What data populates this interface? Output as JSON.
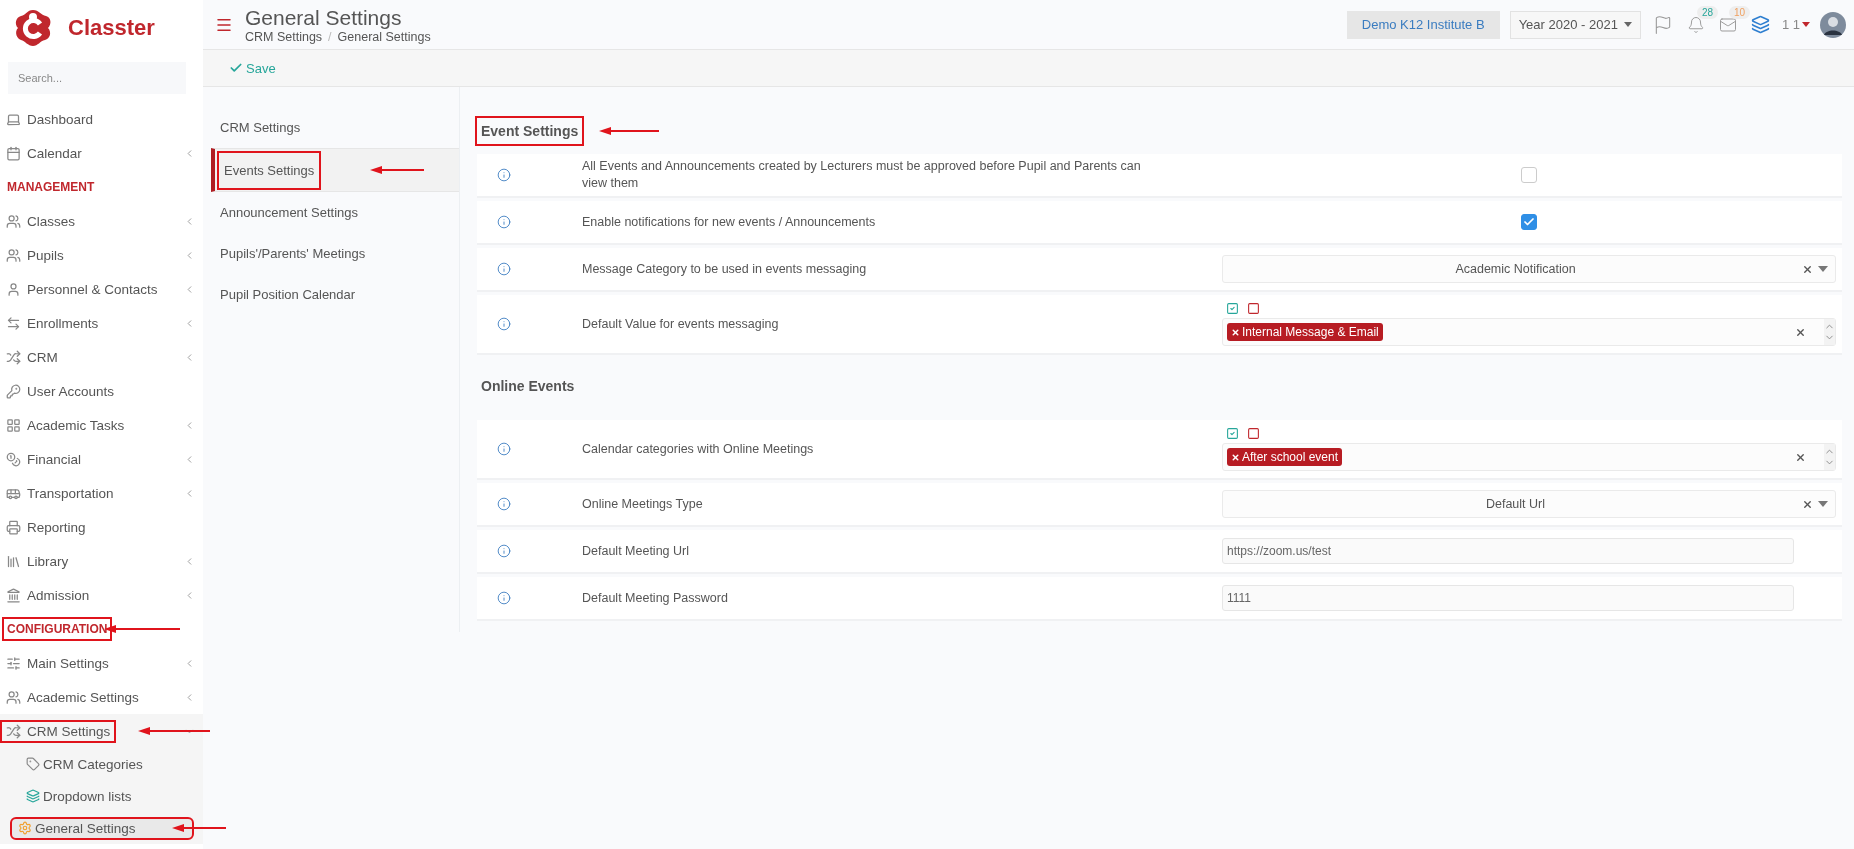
{
  "brand": {
    "name": "Classter"
  },
  "sidebar": {
    "search": {
      "placeholder": "Search..."
    },
    "items": [
      {
        "kind": "item",
        "label": "Dashboard",
        "submenu": false,
        "annotated": false
      },
      {
        "kind": "item",
        "label": "Calendar",
        "submenu": true,
        "expanded": false,
        "annotated": false
      },
      {
        "kind": "section",
        "label": "MANAGEMENT",
        "annotated": false
      },
      {
        "kind": "item",
        "label": "Classes",
        "submenu": true,
        "expanded": false,
        "annotated": false
      },
      {
        "kind": "item",
        "label": "Pupils",
        "submenu": true,
        "expanded": false,
        "annotated": false
      },
      {
        "kind": "item",
        "label": "Personnel & Contacts",
        "submenu": true,
        "expanded": false,
        "annotated": false
      },
      {
        "kind": "item",
        "label": "Enrollments",
        "submenu": true,
        "expanded": false,
        "annotated": false
      },
      {
        "kind": "item",
        "label": "CRM",
        "submenu": true,
        "expanded": false,
        "annotated": false
      },
      {
        "kind": "item",
        "label": "User Accounts",
        "submenu": false,
        "annotated": false
      },
      {
        "kind": "item",
        "label": "Academic Tasks",
        "submenu": true,
        "expanded": false,
        "annotated": false
      },
      {
        "kind": "item",
        "label": "Financial",
        "submenu": true,
        "expanded": false,
        "annotated": false
      },
      {
        "kind": "item",
        "label": "Transportation",
        "submenu": true,
        "expanded": false,
        "annotated": false
      },
      {
        "kind": "item",
        "label": "Reporting",
        "submenu": false,
        "annotated": false
      },
      {
        "kind": "item",
        "label": "Library",
        "submenu": true,
        "expanded": false,
        "annotated": false
      },
      {
        "kind": "item",
        "label": "Admission",
        "submenu": true,
        "expanded": false,
        "annotated": false
      },
      {
        "kind": "section",
        "label": "CONFIGURATION",
        "annotated": true
      },
      {
        "kind": "item",
        "label": "Main Settings",
        "submenu": true,
        "expanded": false,
        "annotated": false
      },
      {
        "kind": "item",
        "label": "Academic Settings",
        "submenu": true,
        "expanded": false,
        "annotated": false
      },
      {
        "kind": "item",
        "label": "CRM Settings",
        "submenu": true,
        "expanded": true,
        "annotated": true,
        "children": [
          {
            "label": "CRM Categories",
            "selected": false,
            "annotated": false
          },
          {
            "label": "Dropdown lists",
            "selected": false,
            "annotated": false
          },
          {
            "label": "General Settings",
            "selected": true,
            "annotated": true
          }
        ]
      }
    ]
  },
  "header": {
    "title": "General Settings",
    "breadcrumb": [
      "CRM Settings",
      "General Settings"
    ],
    "separator": "/",
    "institute": "Demo K12 Institute B",
    "year": "Year 2020 - 2021",
    "notifications": "28",
    "messages": "10",
    "user": "1 1"
  },
  "toolbar": {
    "save": "Save"
  },
  "subnav": [
    {
      "label": "CRM Settings",
      "selected": false,
      "annotated": false
    },
    {
      "label": "Events Settings",
      "selected": true,
      "annotated": true
    },
    {
      "label": "Announcement Settings",
      "selected": false,
      "annotated": false
    },
    {
      "label": "Pupils'/Parents' Meetings",
      "selected": false,
      "annotated": false
    },
    {
      "label": "Pupil Position Calendar",
      "selected": false,
      "annotated": false
    }
  ],
  "sections": [
    {
      "title": "Event Settings",
      "annotated": true,
      "rows": [
        {
          "kind": "checkbox",
          "label": "All Events and Announcements created by Lecturers must be approved before Pupil and Parents can view them",
          "checked": false
        },
        {
          "kind": "checkbox",
          "label": "Enable notifications for new events / Announcements",
          "checked": true
        },
        {
          "kind": "select",
          "label": "Message Category to be used in events messaging",
          "value": "Academic Notification"
        },
        {
          "kind": "multiselect",
          "label": "Default Value for events messaging",
          "tags": [
            "Internal Message & Email"
          ]
        }
      ]
    },
    {
      "title": "Online Events",
      "annotated": false,
      "rows": [
        {
          "kind": "multiselect",
          "label": "Calendar categories with Online Meetings",
          "tags": [
            "After school event"
          ]
        },
        {
          "kind": "select",
          "label": "Online Meetings Type",
          "value": "Default Url"
        },
        {
          "kind": "text",
          "label": "Default Meeting Url",
          "value": "https://zoom.us/test"
        },
        {
          "kind": "text",
          "label": "Default Meeting Password",
          "value": "1111"
        }
      ]
    }
  ]
}
